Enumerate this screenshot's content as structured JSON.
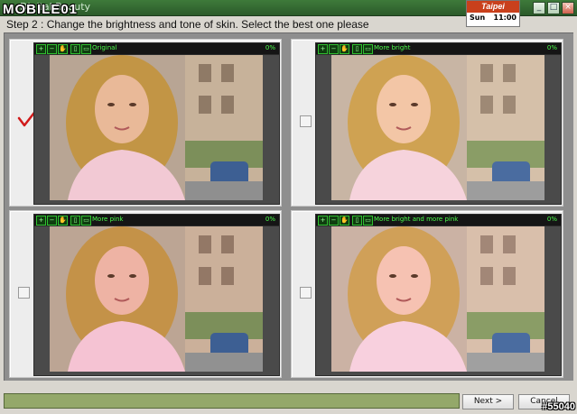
{
  "window": {
    "title": "Digital Beauty",
    "logo_text": "MOBILE01",
    "buttons": [
      "_",
      "□",
      "×"
    ]
  },
  "clock": {
    "city": "Taipei",
    "day": "Sun",
    "time": "11:00"
  },
  "step_text": "Step 2 : Change the brightness and tone of skin. Select the best one please",
  "options": [
    {
      "label": "Original",
      "zoom": "0%",
      "selected": true
    },
    {
      "label": "More bright",
      "zoom": "0%",
      "selected": false
    },
    {
      "label": "More pink",
      "zoom": "0%",
      "selected": false
    },
    {
      "label": "More bright and more pink",
      "zoom": "0%",
      "selected": false
    }
  ],
  "toolbar_icons": [
    "zoom-in-icon",
    "zoom-out-icon",
    "hand-pan-icon",
    "fit-window-icon",
    "actual-size-icon"
  ],
  "footer": {
    "next_label": "Next >",
    "cancel_label": "Cancel"
  },
  "watermark": "#55040",
  "colors": {
    "selected_check": "#d11a1a",
    "viewer_label": "#4cff4c",
    "title_bar": "#2b5a2a"
  }
}
